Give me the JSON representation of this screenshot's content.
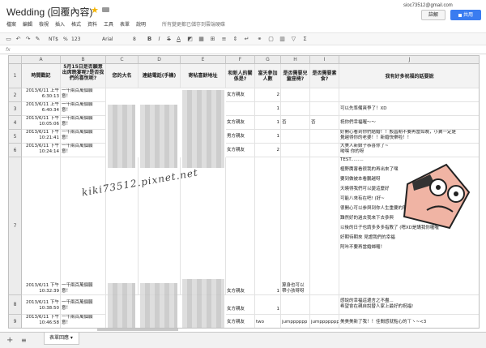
{
  "app": {
    "doc_title": "Wedding (回覆內容)",
    "user_email": "sioc73512@gmail.com",
    "comment_label": "註解",
    "share_label": "共用"
  },
  "menu": [
    "檔案",
    "編輯",
    "檢視",
    "插入",
    "格式",
    "資料",
    "工具",
    "表單",
    "說明"
  ],
  "save_status": "所有變更都已儲存到雲端硬碟",
  "toolbar": {
    "zoom": "NT$",
    "percent": "%",
    "decimals": "123",
    "font": "Arial",
    "size": "8"
  },
  "columns": [
    "A",
    "B",
    "C",
    "D",
    "E",
    "F",
    "G",
    "H",
    "I",
    "J"
  ],
  "header_row": {
    "a": "時間戳記",
    "b": "5月15日是否願意出席晚宴呢?是否我們的喜悅呢?",
    "c": "您的大名",
    "d": "連絡電話(手機)",
    "e": "寄帖喜餅地址",
    "f": "和新人的關係是?",
    "g": "當天參加人數",
    "h": "是否需要兒童座椅?",
    "i": "是否需要素食?",
    "j": "我有好多祝福的話要說"
  },
  "rows": [
    {
      "num": "2",
      "a": "2013/6/11 上午\n6:30:13",
      "b": "一千兩百萬個願\n意！",
      "f": "女方親友",
      "g": "2",
      "h": "",
      "i": "",
      "j": ""
    },
    {
      "num": "3",
      "a": "2013/6/11 上午\n6:40:34",
      "b": "一千兩百萬個願\n意！",
      "f": "",
      "g": "1",
      "h": "",
      "i": "",
      "j": "可以先準備爽爭了！XD"
    },
    {
      "num": "4",
      "a": "2013/6/11 下午\n10:05:06",
      "b": "一千兩百萬個願\n意！",
      "f": "女方親友",
      "g": "1",
      "h": "否",
      "i": "否",
      "j": "祝你們幸福喔～～"
    },
    {
      "num": "5",
      "a": "2013/6/11 下午\n10:21:41",
      "b": "一千兩百萬個願\n意！",
      "f": "男方親友",
      "g": "1",
      "h": "",
      "i": "",
      "j": "好開心看到你們結婚！！殷昌期不要再當如晚，小翼一定是\n覺越得你的老婆！！新婚快樂啦！！"
    },
    {
      "num": "6",
      "a": "2013/6/11 下午\n10:24:14",
      "b": "一千兩百萬個願\n意！",
      "f": "女方親友",
      "g": "2",
      "h": "",
      "i": "",
      "j": "大美人新娘子恭喜你了~\n呦嘿 你的呀"
    },
    {
      "num": "7",
      "a": "2013/6/11 下午\n10:32:39",
      "b": "一千兩百萬個願\n意！",
      "f": "女方親友",
      "g": "1",
      "h": "算身也可以\n帶小孩呀呀",
      "i": "",
      "j": "TEST.........\n\n植野厲害看很我的再出來了嘿\n\n要到做被本看鵬越呀\n\n天曉得我們可以變這麼好\n\n可能八來有在吧! (好~\n\n很開心可以参與到你人生重要的階段\n\n難然好的過去我來下去參與\n\n以後的日子也請多多多指教了 (嗯XD是講我你喔喔\n\n好期待期來 見證我們的幸福\n\n阿咔不要再當婚婦囉！"
    },
    {
      "num": "8",
      "a": "2013/6/11 下午\n10:38:50",
      "b": "一千兩百萬個願\n意！",
      "f": "女方親友",
      "g": "1",
      "h": "",
      "i": "",
      "j": "感說的幸福這邊言之不盡...\n希望會在親自說替人家上最好的祝福!"
    },
    {
      "num": "9",
      "a": "2013/6/11 下午\n10:46:58",
      "b": "一千兩百萬個願\n意！",
      "f": "女方親友",
      "g": "two",
      "h": "jumpppppp",
      "i": "jumppppppp",
      "j": "美美美新了我！！佳間感就點心的ㄒヽ~<3"
    }
  ],
  "watermark": "kiki73512.pixnet.net",
  "sheet_tab": "表單回應"
}
